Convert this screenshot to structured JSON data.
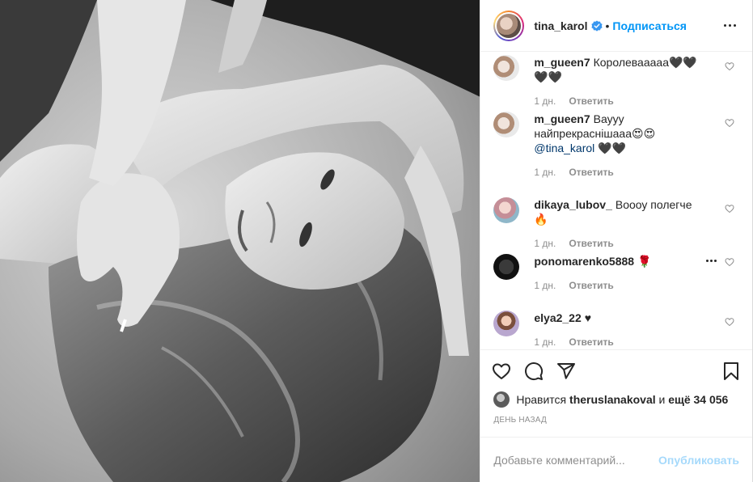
{
  "header": {
    "username": "tina_karol",
    "verified": true,
    "separator": "•",
    "follow_label": "Подписаться",
    "more_icon": "more-horizontal-icon"
  },
  "comments": [
    {
      "user": "m_gueen7",
      "text": "Королевааааа🖤🖤🖤🖤",
      "mention": "",
      "after_mention": "",
      "age": "1 дн.",
      "reply": "Ответить"
    },
    {
      "user": "m_gueen7",
      "text": "Вауyy найпрекраснішааа😍😍",
      "mention": "@tina_karol",
      "after_mention": "🖤🖤",
      "age": "1 дн.",
      "reply": "Ответить"
    },
    {
      "user": "dikaya_lubov_",
      "text": "Воооу полегче🔥",
      "mention": "",
      "after_mention": "",
      "age": "1 дн.",
      "reply": "Ответить"
    },
    {
      "user": "ponomarenko5888",
      "text": "🌹",
      "mention": "",
      "after_mention": "",
      "age": "1 дн.",
      "reply": "Ответить"
    },
    {
      "user": "elya2_22",
      "text": "♥",
      "mention": "",
      "after_mention": "",
      "age": "1 дн.",
      "reply": "Ответить"
    }
  ],
  "likes": {
    "prefix": "Нравится",
    "user": "theruslanakoval",
    "middle": "и",
    "others": "ещё 34 056"
  },
  "timestamp": "День назад",
  "add_comment": {
    "placeholder": "Добавьте комментарий...",
    "publish_label": "Опубликовать"
  },
  "colors": {
    "accent": "#0095f6",
    "text": "#262626",
    "muted": "#8e8e8e",
    "border": "#efefef"
  }
}
